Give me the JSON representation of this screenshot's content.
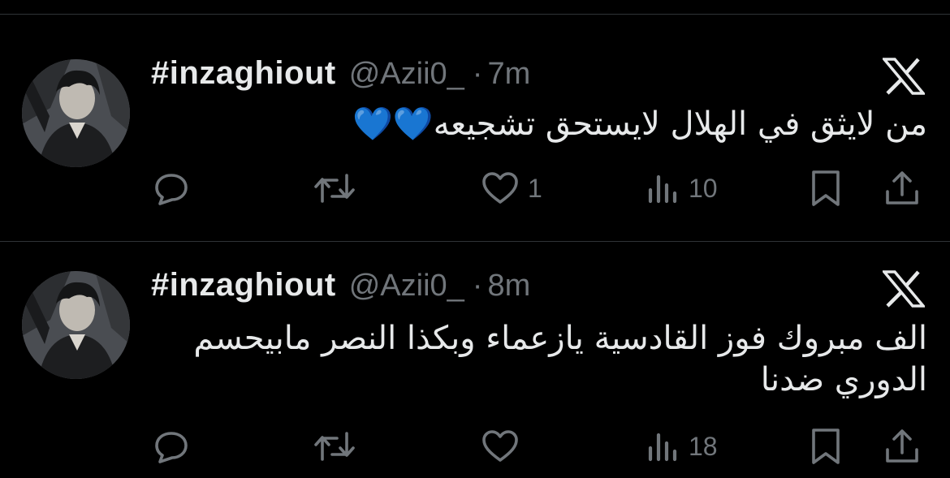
{
  "tweets": [
    {
      "display_name": "#inzaghiout",
      "handle": "@Azii0_",
      "dot": "·",
      "time": "7m",
      "text": "من لايثق في الهلال لايستحق تشجيعه💙💙",
      "actions": {
        "reply_count": "",
        "retweet_count": "",
        "like_count": "1",
        "views_count": "10"
      }
    },
    {
      "display_name": "#inzaghiout",
      "handle": "@Azii0_",
      "dot": "·",
      "time": "8m",
      "text": "الف مبروك فوز القادسية يازعماء وبكذا النصر مابيحسم الدوري ضدنا",
      "actions": {
        "reply_count": "",
        "retweet_count": "",
        "like_count": "",
        "views_count": "18"
      }
    }
  ],
  "icons": {
    "reply": "reply-icon",
    "retweet": "retweet-icon",
    "like": "heart-icon",
    "views": "views-icon",
    "bookmark": "bookmark-icon",
    "share": "share-icon",
    "logo": "x-logo-icon"
  },
  "colors": {
    "background": "#000000",
    "text": "#e7e9ea",
    "secondary": "#71767b",
    "divider": "#2f3336",
    "heart_emoji": "#1d8cf8"
  }
}
